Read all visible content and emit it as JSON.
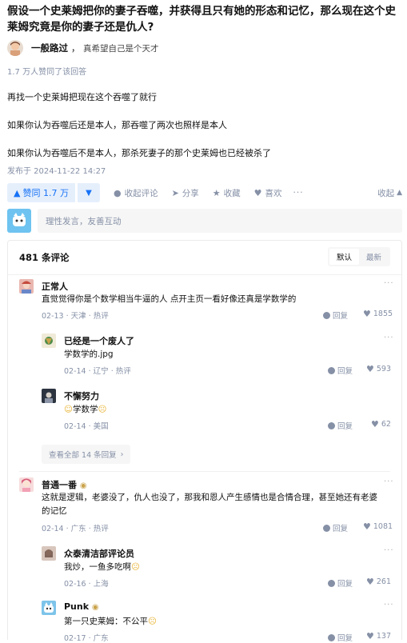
{
  "question": {
    "title": "假设一个史莱姆把你的妻子吞噬，并获得且只有她的形态和记忆，那么现在这个史莱姆究竟是你的妻子还是仇人?"
  },
  "author": {
    "name": "一般路过",
    "separator": "，",
    "bio": "真希望自己是个天才"
  },
  "vote_summary": "1.7 万人赞同了该回答",
  "answer": {
    "paragraphs": [
      "再找一个史莱姆把现在这个吞噬了就行",
      "如果你认为吞噬后还是本人，那吞噬了两次也照样是本人",
      "如果你认为吞噬后不是本人，那杀死妻子的那个史莱姆也已经被杀了"
    ],
    "published": "发布于 2024-11-22 14:27"
  },
  "actions": {
    "upvote": "赞同 1.7 万",
    "collect_comments": "收起评论",
    "share": "分享",
    "favorite": "收藏",
    "like": "喜欢",
    "more": "···",
    "collapse": "收起"
  },
  "comment_input": {
    "placeholder": "理性发言，友善互动"
  },
  "comments_panel": {
    "count": "481 条评论",
    "sort_default": "默认",
    "sort_latest": "最新",
    "view_all": "查看全部 14 条回复",
    "reply_label": "回复",
    "more": "···",
    "threads": [
      {
        "name": "正常人",
        "text": "直觉觉得你是个数学相当牛逼的人 点开主页一看好像还真是学数学的",
        "date": "02-13",
        "location": "天津",
        "tag": "热评",
        "likes": "1855",
        "replies": [
          {
            "name": "已经是一个废人了",
            "text": "学数学的.jpg",
            "date": "02-14",
            "location": "辽宁",
            "tag": "热评",
            "likes": "593"
          },
          {
            "name": "不懈努力",
            "text": "学数学",
            "date": "02-14",
            "location": "美国",
            "tag": "",
            "likes": "62"
          }
        ]
      },
      {
        "name": "普通一番",
        "text": "这就是逻辑，老婆没了，仇人也没了，那我和恩人产生感情也是合情合理，甚至她还有老婆的记忆",
        "date": "02-14",
        "location": "广东",
        "tag": "热评",
        "likes": "1081",
        "replies": [
          {
            "name": "众泰清洁部评论员",
            "text": "我炒，一鱼多吃啊",
            "date": "02-16",
            "location": "上海",
            "tag": "",
            "likes": "261"
          },
          {
            "name": "Punk",
            "text": "第一只史莱姆：不公平",
            "date": "02-17",
            "location": "广东",
            "tag": "",
            "likes": "137"
          }
        ]
      }
    ]
  },
  "colors": {
    "accent": "#1772f6",
    "accent_bg": "#e5effc",
    "meta_gray": "#8590a6"
  }
}
